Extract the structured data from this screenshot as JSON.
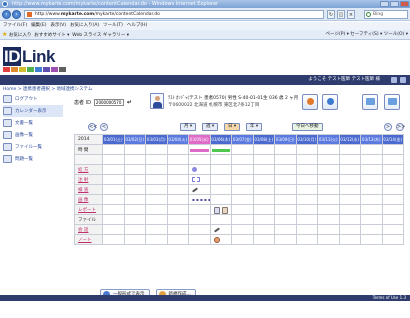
{
  "window": {
    "title": "http://www.mykarte.com/mykarte/contentCalendar.do - Windows Internet Explorer"
  },
  "address": {
    "prefix": "http://www.",
    "domain": "mykarte.com",
    "suffix": "/mykarte/contentCalendar.do",
    "search_placeholder": "Bing"
  },
  "menu": [
    "ファイル(F)",
    "編集(E)",
    "表示(V)",
    "お気に入り(A)",
    "ツール(T)",
    "ヘルプ(H)"
  ],
  "favorites": {
    "label": "お気に入り",
    "item1": "おすすめサイト ▾",
    "item2": "Web スライス ギャラリー ▾",
    "tools": "ページ(P) ▾  セーフティ(S) ▾  ツール(O) ▾"
  },
  "brand": {
    "logo_id": "ID",
    "logo_rest": "Link",
    "banner_text": "ようこそ テスト医師 テスト医師 様"
  },
  "breadcrumb": "Home > 連携患者選択 > 地域連携システム",
  "sidebar": [
    {
      "label": "ログアウト"
    },
    {
      "label": "カレンダー表示"
    },
    {
      "label": "文書一覧"
    },
    {
      "label": "画像一覧"
    },
    {
      "label": "ファイル一覧"
    },
    {
      "label": "問題一覧"
    }
  ],
  "patient": {
    "id_label": "患者 ID",
    "id_value": "2000000570",
    "enter_glyph": "↵",
    "line1": "ﾃｽﾄ ｶﾝｼﾞｬ(テスト 患者0570) 男性 S-40-01-01生 036 歳 2 ヶ月",
    "line2": "〒0600022 北海道 札幌市 東区北7条12丁目"
  },
  "calnav": {
    "prev": "<<",
    "prev2": "<",
    "views": [
      "月 ▾",
      "週 ▾",
      "日 ▾",
      "年 ▾"
    ],
    "selected_view": 2,
    "today": "今日へ移動",
    "next": ">",
    "next2": ">>"
  },
  "calendar": {
    "year": "2014",
    "header_label": "時 間",
    "days": [
      "03/01(土)",
      "03/02(日)",
      "03/03(月)",
      "03/04(火)",
      "03/05(水)",
      "03/06(木)",
      "03/07(金)",
      "03/08(土)",
      "03/09(日)",
      "03/10(月)",
      "03/11(火)",
      "03/12(水)",
      "03/13(木)",
      "03/14(金)"
    ],
    "rows": [
      "処 方",
      "注 射",
      "検 査",
      "画 像",
      "レポート",
      "ファイル",
      "会 話",
      "ノート"
    ]
  },
  "bottom": {
    "btn1": "一般形式で表示",
    "btn2": "新規作成..."
  },
  "footer": "Terms of Use  1.3",
  "colors": {
    "accent": "#2e3d6e",
    "day_header": "#4a6ad0",
    "current_day": "#e06ac8",
    "row_label": "#c0306a"
  }
}
